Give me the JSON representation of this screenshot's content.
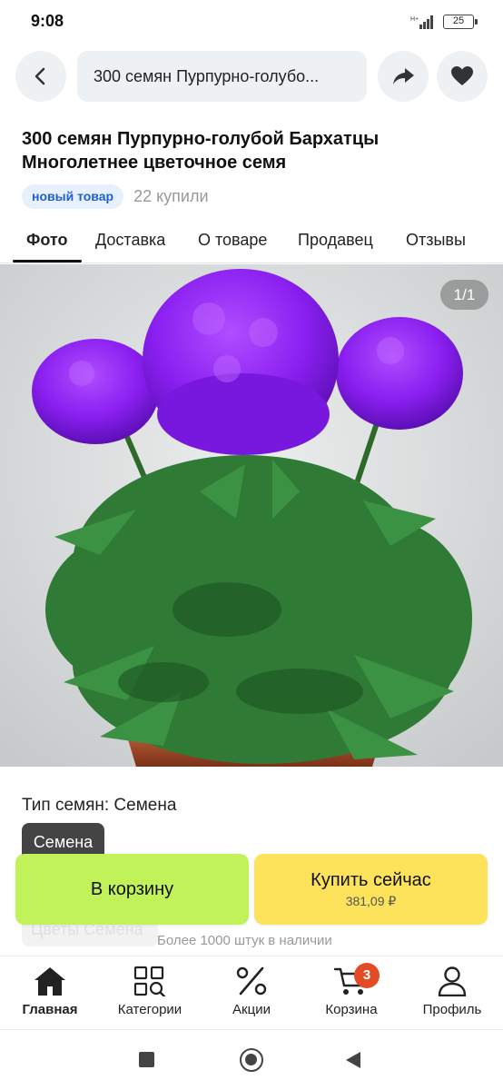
{
  "status_bar": {
    "time": "9:08",
    "network": "H+",
    "battery": "25"
  },
  "header": {
    "search_text": "300 семян Пурпурно-голубо..."
  },
  "product": {
    "title": "300 семян Пурпурно-голубой Бархатцы Многолетнее цветочное семя",
    "badge": "новый товар",
    "bought": "22 купили"
  },
  "tabs": [
    {
      "label": "Фото",
      "active": true
    },
    {
      "label": "Доставка",
      "active": false
    },
    {
      "label": "О товаре",
      "active": false
    },
    {
      "label": "Продавец",
      "active": false
    },
    {
      "label": "Отзывы",
      "active": false
    }
  ],
  "gallery": {
    "counter": "1/1",
    "image_subject": "purple marigold flowers in pot"
  },
  "options": {
    "seed_type_label": "Тип семян: Семена",
    "selected_option": "Семена",
    "faded_option": "Цветы Семена",
    "stock": "Более 1000 штук в наличии"
  },
  "actions": {
    "cart_label": "В корзину",
    "buy_label": "Купить сейчас",
    "price": "381,09 ₽"
  },
  "bottom_nav": [
    {
      "label": "Главная",
      "icon": "home-icon"
    },
    {
      "label": "Категории",
      "icon": "categories-icon"
    },
    {
      "label": "Акции",
      "icon": "percent-icon"
    },
    {
      "label": "Корзина",
      "icon": "cart-icon",
      "badge": "3"
    },
    {
      "label": "Профиль",
      "icon": "profile-icon"
    }
  ],
  "colors": {
    "accent_green": "#c1f25a",
    "accent_yellow": "#fde35c",
    "badge_blue": "#1f5fd6",
    "cart_badge": "#e24b25"
  }
}
